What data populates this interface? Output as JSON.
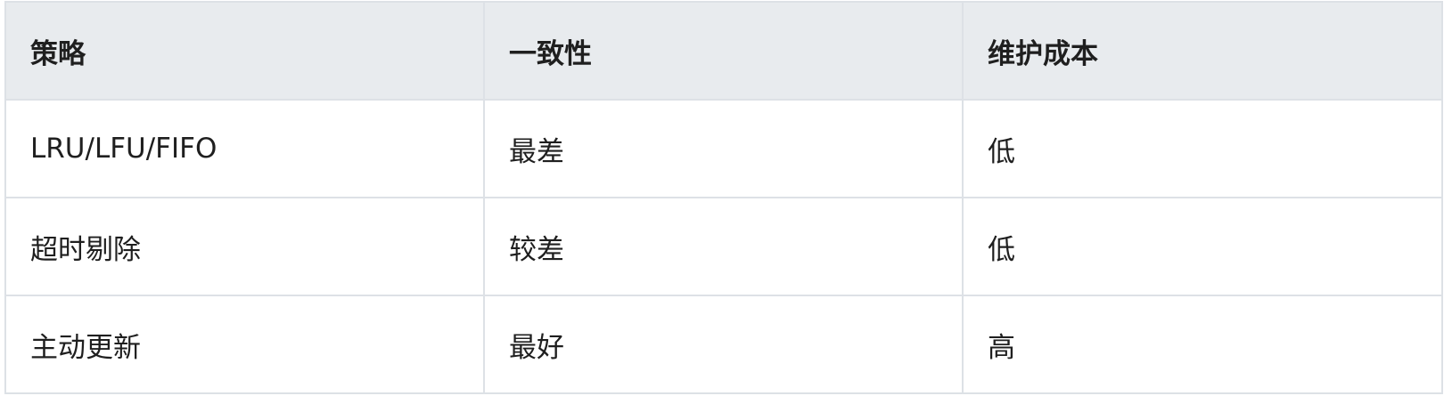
{
  "table": {
    "headers": [
      "策略",
      "一致性",
      "维护成本"
    ],
    "rows": [
      [
        "LRU/LFU/FIFO",
        "最差",
        "低"
      ],
      [
        "超时剔除",
        "较差",
        "低"
      ],
      [
        "主动更新",
        "最好",
        "高"
      ]
    ]
  },
  "colors": {
    "header_bg": "#e8ebee",
    "border": "#dde1e6",
    "text": "#1f1f1f"
  }
}
